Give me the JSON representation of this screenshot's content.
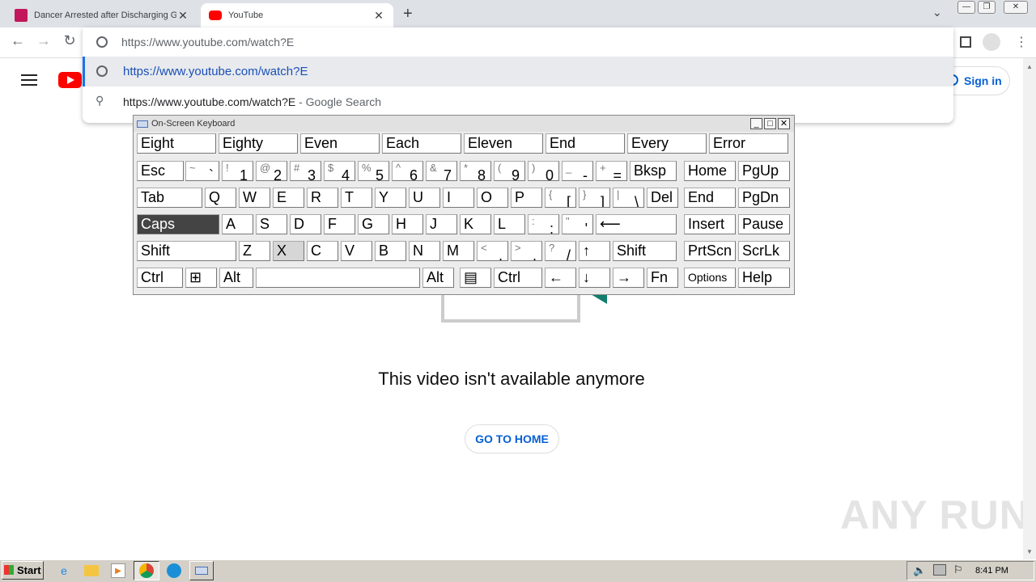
{
  "browser": {
    "tabs": [
      {
        "title": "Dancer Arrested after Discharging G",
        "icon": "news-favicon"
      },
      {
        "title": "YouTube",
        "icon": "youtube-favicon"
      }
    ],
    "new_tab": "+",
    "omnibox": {
      "value": "https://www.youtube.com/watch?E",
      "suggestions": [
        {
          "text": "https://www.youtube.com/watch?E",
          "suffix": ""
        },
        {
          "text": "https://www.youtube.com/watch?E",
          "suffix": " - Google Search"
        }
      ]
    }
  },
  "page": {
    "signin": "Sign in",
    "message": "This video isn't available anymore",
    "go_home": "GO TO HOME",
    "watermark": "ANY RUN"
  },
  "osk": {
    "title": "On-Screen Keyboard",
    "predictions": [
      "Eight",
      "Eighty",
      "Even",
      "Each",
      "Eleven",
      "End",
      "Every",
      "Error"
    ],
    "rows": [
      [
        {
          "main": "Esc"
        },
        {
          "shift": "~",
          "main": "`"
        },
        {
          "shift": "!",
          "main": "1"
        },
        {
          "shift": "@",
          "main": "2"
        },
        {
          "shift": "#",
          "main": "3"
        },
        {
          "shift": "$",
          "main": "4"
        },
        {
          "shift": "%",
          "main": "5"
        },
        {
          "shift": "^",
          "main": "6"
        },
        {
          "shift": "&",
          "main": "7"
        },
        {
          "shift": "*",
          "main": "8"
        },
        {
          "shift": "(",
          "main": "9"
        },
        {
          "shift": ")",
          "main": "0"
        },
        {
          "shift": "_",
          "main": "-"
        },
        {
          "shift": "+",
          "main": "="
        },
        {
          "main": "Bksp"
        },
        {
          "main": "Home"
        },
        {
          "main": "PgUp"
        }
      ],
      [
        {
          "main": "Tab"
        },
        {
          "main": "Q"
        },
        {
          "main": "W"
        },
        {
          "main": "E"
        },
        {
          "main": "R"
        },
        {
          "main": "T"
        },
        {
          "main": "Y"
        },
        {
          "main": "U"
        },
        {
          "main": "I"
        },
        {
          "main": "O"
        },
        {
          "main": "P"
        },
        {
          "shift": "{",
          "main": "["
        },
        {
          "shift": "}",
          "main": "]"
        },
        {
          "shift": "|",
          "main": "\\"
        },
        {
          "main": "Del"
        },
        {
          "main": "End"
        },
        {
          "main": "PgDn"
        }
      ],
      [
        {
          "main": "Caps"
        },
        {
          "main": "A"
        },
        {
          "main": "S"
        },
        {
          "main": "D"
        },
        {
          "main": "F"
        },
        {
          "main": "G"
        },
        {
          "main": "H"
        },
        {
          "main": "J"
        },
        {
          "main": "K"
        },
        {
          "main": "L"
        },
        {
          "shift": ":",
          "main": ";"
        },
        {
          "shift": "\"",
          "main": "'"
        },
        {
          "main": "⟵"
        },
        {
          "main": "Insert"
        },
        {
          "main": "Pause"
        }
      ],
      [
        {
          "main": "Shift"
        },
        {
          "main": "Z"
        },
        {
          "main": "X"
        },
        {
          "main": "C"
        },
        {
          "main": "V"
        },
        {
          "main": "B"
        },
        {
          "main": "N"
        },
        {
          "main": "M"
        },
        {
          "shift": "<",
          "main": ","
        },
        {
          "shift": ">",
          "main": "."
        },
        {
          "shift": "?",
          "main": "/"
        },
        {
          "main": "↑"
        },
        {
          "main": "Shift"
        },
        {
          "main": "PrtScn"
        },
        {
          "main": "ScrLk"
        }
      ],
      [
        {
          "main": "Ctrl"
        },
        {
          "main": "⊞"
        },
        {
          "main": "Alt"
        },
        {
          "main": ""
        },
        {
          "main": "Alt"
        },
        {
          "main": "▤"
        },
        {
          "main": "Ctrl"
        },
        {
          "main": "←"
        },
        {
          "main": "↓"
        },
        {
          "main": "→"
        },
        {
          "main": "Fn"
        },
        {
          "main": "Options"
        },
        {
          "main": "Help"
        }
      ]
    ]
  },
  "taskbar": {
    "start": "Start",
    "items": [
      "ie-icon",
      "explorer-icon",
      "media-player-icon",
      "chrome-icon",
      "edge-icon",
      "osk-icon"
    ],
    "clock": "8:41 PM"
  }
}
